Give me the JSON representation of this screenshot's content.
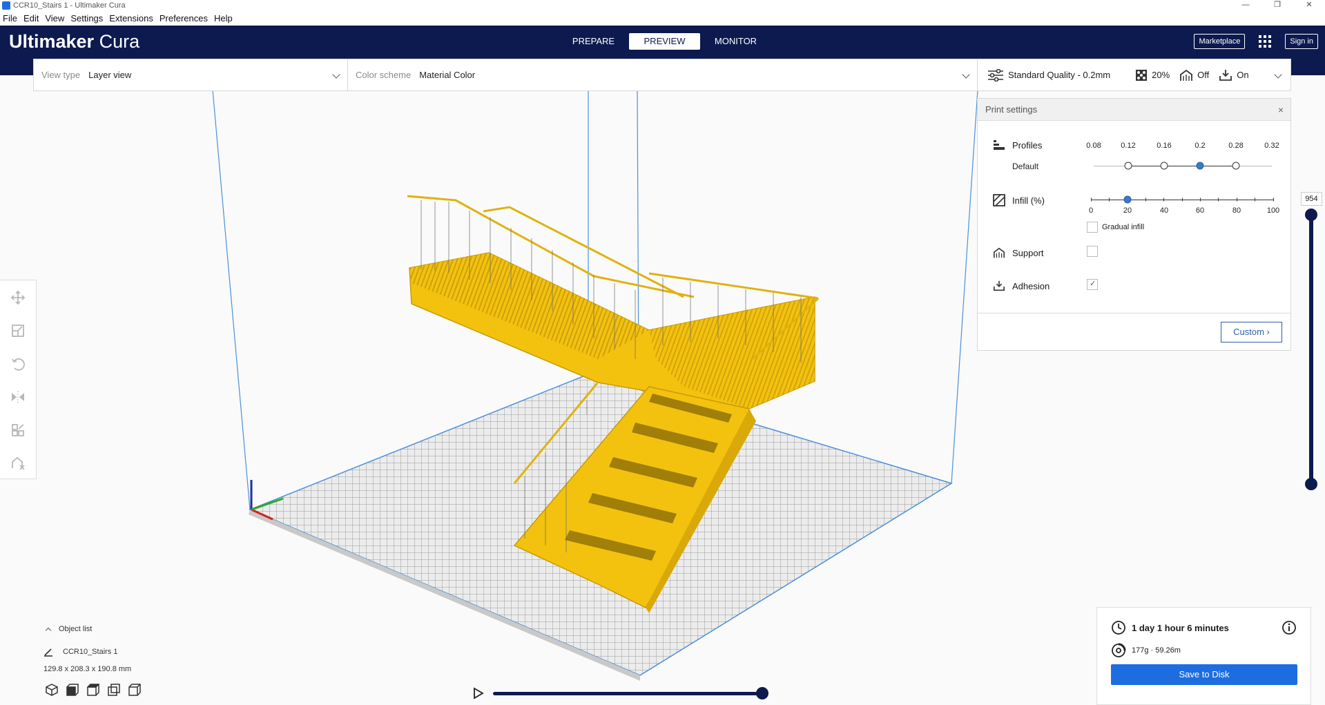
{
  "window": {
    "title": "CCR10_Stairs 1 - Ultimaker Cura",
    "controls": [
      "—",
      "❐",
      "✕"
    ]
  },
  "menu": [
    "File",
    "Edit",
    "View",
    "Settings",
    "Extensions",
    "Preferences",
    "Help"
  ],
  "header": {
    "brand_bold": "Ultimaker",
    "brand_light": " Cura",
    "tabs": [
      "PREPARE",
      "PREVIEW",
      "MONITOR"
    ],
    "active_tab": "PREVIEW",
    "marketplace": "Marketplace",
    "signin": "Sign in"
  },
  "viewbar": {
    "view_type_label": "View type",
    "view_type_value": "Layer view",
    "color_scheme_label": "Color scheme",
    "color_scheme_value": "Material Color"
  },
  "summary": {
    "quality": "Standard Quality - 0.2mm",
    "infill": "20%",
    "support": "Off",
    "adhesion": "On"
  },
  "print_settings": {
    "title": "Print settings",
    "close": "×",
    "profiles_label": "Profiles",
    "profiles_sub": "Default",
    "profile_ticks": [
      "0.08",
      "0.12",
      "0.16",
      "0.2",
      "0.28",
      "0.32"
    ],
    "profile_selected": "0.2",
    "infill_label": "Infill (%)",
    "infill_ticks": [
      "0",
      "20",
      "40",
      "60",
      "80",
      "100"
    ],
    "infill_value": 20,
    "gradual_infill_label": "Gradual infill",
    "gradual_infill_checked": false,
    "support_label": "Support",
    "support_checked": false,
    "adhesion_label": "Adhesion",
    "adhesion_checked": true,
    "custom_button": "Custom"
  },
  "layer_slider": {
    "value": "954"
  },
  "object_list": {
    "header": "Object list",
    "object_name": "CCR10_Stairs 1",
    "dimensions": "129.8 x 208.3 x 190.8 mm"
  },
  "estimate": {
    "time": "1 day 1 hour 6 minutes",
    "material": "177g · 59.26m",
    "save_button": "Save to Disk"
  },
  "colors": {
    "header_bg": "#0d1a4f",
    "accent_blue": "#1e6de0",
    "model_yellow": "#f5c518"
  }
}
